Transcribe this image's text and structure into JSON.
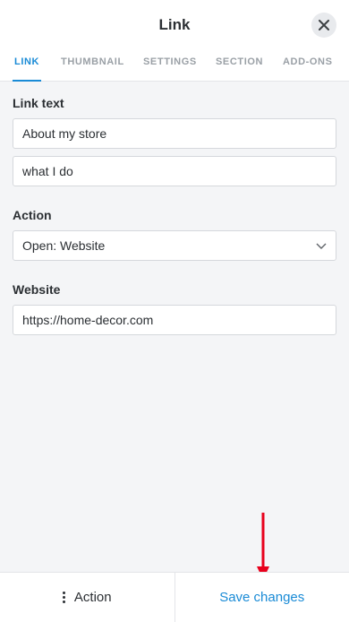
{
  "header": {
    "title": "Link"
  },
  "tabs": [
    {
      "label": "LINK"
    },
    {
      "label": "THUMBNAIL"
    },
    {
      "label": "SETTINGS"
    },
    {
      "label": "SECTION"
    },
    {
      "label": "ADD-ONS"
    }
  ],
  "link_text": {
    "label": "Link text",
    "line1": "About my store",
    "line2": "what I do"
  },
  "action": {
    "label": "Action",
    "selected": "Open: Website"
  },
  "website": {
    "label": "Website",
    "value": "https://home-decor.com"
  },
  "footer": {
    "action_label": "Action",
    "save_label": "Save changes"
  },
  "colors": {
    "accent": "#1a8bd6",
    "annotation_arrow": "#e8001c"
  }
}
